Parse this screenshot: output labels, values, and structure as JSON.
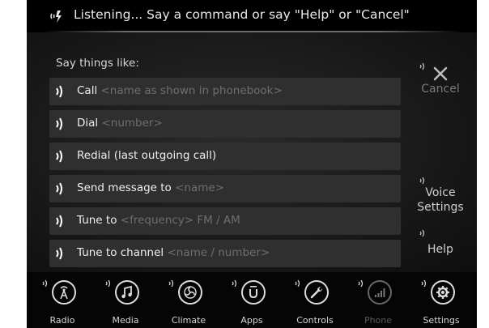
{
  "status": {
    "text": "Listening... Say a command or say \"Help\" or \"Cancel\""
  },
  "hint": "Say things like:",
  "commands": [
    {
      "cmd": "Call",
      "arg": "<name as shown in phonebook>"
    },
    {
      "cmd": "Dial",
      "arg": "<number>"
    },
    {
      "cmd": "Redial (last outgoing call)",
      "arg": ""
    },
    {
      "cmd": "Send message to",
      "arg": "<name>"
    },
    {
      "cmd": "Tune to",
      "arg": "<frequency> FM / AM"
    },
    {
      "cmd": "Tune to channel",
      "arg": "<name / number>"
    }
  ],
  "side": {
    "cancel": "Cancel",
    "voice_settings_1": "Voice",
    "voice_settings_2": "Settings",
    "help": "Help"
  },
  "dock": [
    {
      "label": "Radio",
      "icon": "radio-antenna-icon"
    },
    {
      "label": "Media",
      "icon": "music-note-icon"
    },
    {
      "label": "Climate",
      "icon": "climate-fan-icon"
    },
    {
      "label": "Apps",
      "icon": "apps-u-icon"
    },
    {
      "label": "Controls",
      "icon": "wrench-icon"
    },
    {
      "label": "Phone",
      "icon": "signal-bars-icon",
      "disabled": true
    },
    {
      "label": "Settings",
      "icon": "gear-icon"
    }
  ],
  "colors": {
    "background": "#000000",
    "row": "#2f2f2f",
    "text": "#eeeeee",
    "muted": "#6e6e6e"
  }
}
